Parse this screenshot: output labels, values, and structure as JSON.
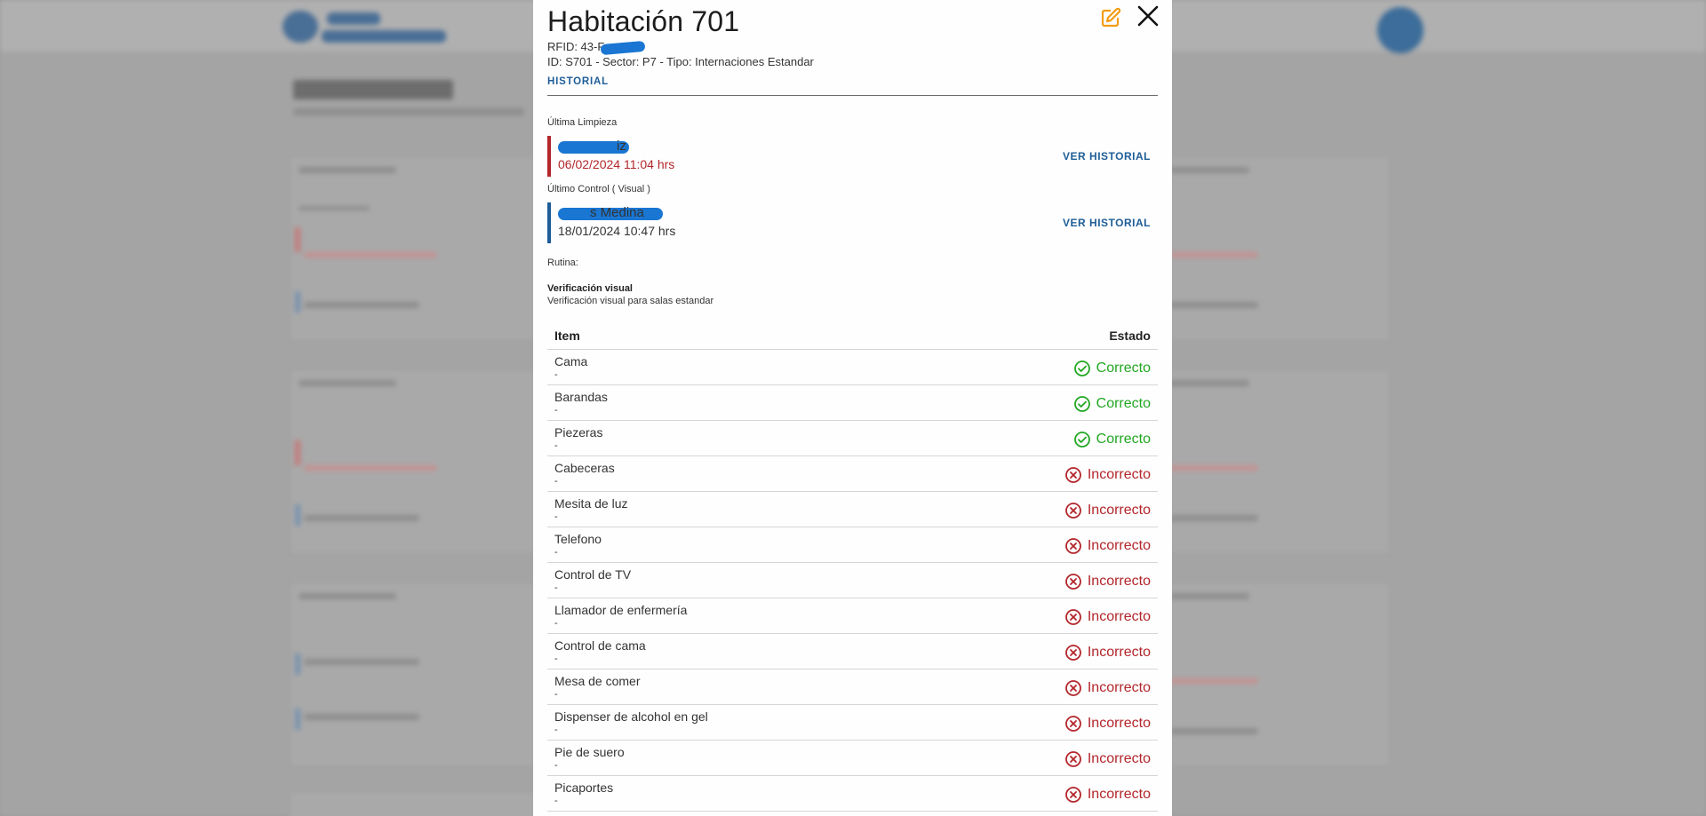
{
  "modal": {
    "title": "Habitación 701",
    "rfid": "RFID: 43-F",
    "meta": "ID: S701 - Sector: P7 - Tipo: Internaciones Estandar",
    "tab": "HISTORIAL"
  },
  "limpieza": {
    "label": "Última Limpieza",
    "name_suffix": "iz",
    "date": "06/02/2024 11:04 hrs",
    "action": "VER HISTORIAL",
    "color": "#b3262b"
  },
  "control": {
    "label": "Último Control ( Visual )",
    "name_suffix": "s Medina",
    "date": "18/01/2024 10:47 hrs",
    "action": "VER HISTORIAL",
    "color": "#1e5d97"
  },
  "rutina": {
    "label": "Rutina:",
    "title": "Verificación visual",
    "description": "Verificación visual para salas estandar"
  },
  "table": {
    "col_item": "Item",
    "col_estado": "Estado",
    "rows": [
      {
        "name": "Cama",
        "note": "-",
        "status": "Correcto"
      },
      {
        "name": "Barandas",
        "note": "-",
        "status": "Correcto"
      },
      {
        "name": "Piezeras",
        "note": "-",
        "status": "Correcto"
      },
      {
        "name": "Cabeceras",
        "note": "-",
        "status": "Incorrecto"
      },
      {
        "name": "Mesita de luz",
        "note": "-",
        "status": "Incorrecto"
      },
      {
        "name": "Telefono",
        "note": "-",
        "status": "Incorrecto"
      },
      {
        "name": "Control de TV",
        "note": "-",
        "status": "Incorrecto"
      },
      {
        "name": "Llamador de enfermería",
        "note": "-",
        "status": "Incorrecto"
      },
      {
        "name": "Control de cama",
        "note": "-",
        "status": "Incorrecto"
      },
      {
        "name": "Mesa de comer",
        "note": "-",
        "status": "Incorrecto"
      },
      {
        "name": "Dispenser de alcohol en gel",
        "note": "-",
        "status": "Incorrecto"
      },
      {
        "name": "Pie de suero",
        "note": "-",
        "status": "Incorrecto"
      },
      {
        "name": "Picaportes",
        "note": "-",
        "status": "Incorrecto"
      }
    ]
  },
  "colors": {
    "ok": "#22a722",
    "bad": "#b3262b",
    "accent": "#1e5d97",
    "edit": "#f39c12"
  },
  "icons": {
    "edit": "edit-icon",
    "close": "close-icon",
    "ok": "check-circle-icon",
    "bad": "x-circle-icon"
  }
}
